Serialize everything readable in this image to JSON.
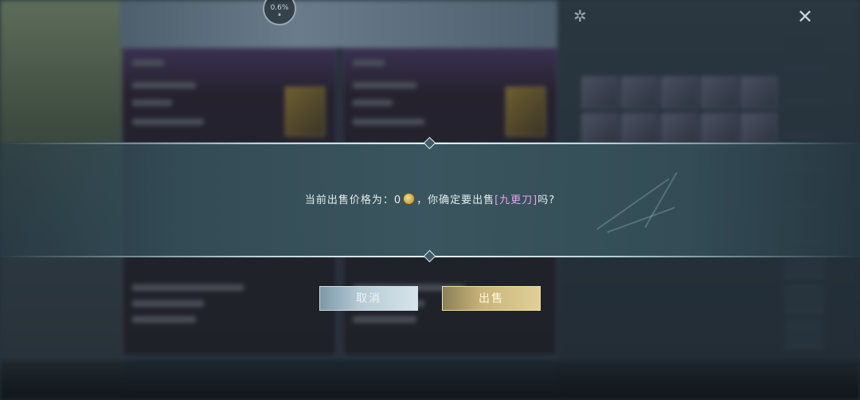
{
  "hud": {
    "progress_text": "0.6%",
    "pause_glyph": "⏸",
    "close_glyph": "✕",
    "gear_glyph": "✲"
  },
  "dialog": {
    "message_prefix": "当前出售价格为：0",
    "message_middle": "，你确定要出售",
    "item_name": "[九更刀]",
    "message_suffix": "吗?",
    "cancel_label": "取消",
    "confirm_label": "出售",
    "item_name_color": "#e8a3ee"
  }
}
